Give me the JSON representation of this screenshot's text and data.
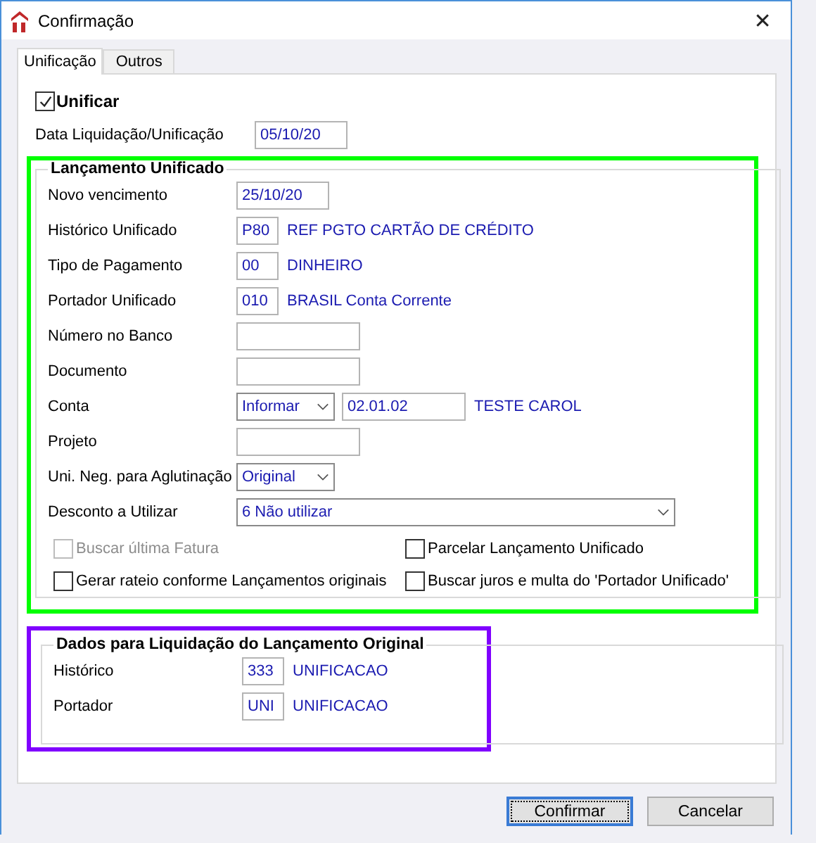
{
  "window": {
    "title": "Confirmação",
    "close": "✕"
  },
  "tabs": [
    {
      "label": "Unificação",
      "selected": true
    },
    {
      "label": "Outros",
      "selected": false
    }
  ],
  "unificar": {
    "label": "Unificar",
    "checked": true
  },
  "data_liquidacao": {
    "label": "Data Liquidação/Unificação",
    "value": "05/10/20"
  },
  "lancamento_unificado": {
    "title": "Lançamento Unificado",
    "color": "#00ff00",
    "rows": [
      {
        "kind": "date",
        "label": "Novo vencimento",
        "value": "25/10/20"
      },
      {
        "kind": "code",
        "label": "Histórico Unificado",
        "value": "P80",
        "description": "REF PGTO CARTÃO DE CRÉDITO"
      },
      {
        "kind": "code",
        "label": "Tipo de Pagamento",
        "value": "00",
        "description": "DINHEIRO"
      },
      {
        "kind": "code",
        "label": "Portador Unificado",
        "value": "010",
        "description": "BRASIL Conta Corrente"
      },
      {
        "kind": "text",
        "label": "Número no Banco"
      },
      {
        "kind": "text",
        "label": "Documento"
      },
      {
        "kind": "account",
        "label": "Conta",
        "select": "Informar",
        "value": "02.01.02",
        "description": "TESTE CAROL"
      },
      {
        "kind": "text",
        "label": "Projeto"
      },
      {
        "kind": "select",
        "label": "Uni. Neg. para Aglutinação",
        "value": "Original"
      },
      {
        "kind": "wide-select",
        "label": "Desconto a Utilizar",
        "value": "6 Não utilizar"
      }
    ],
    "options": [
      {
        "label": "Buscar última Fatura",
        "checked": false,
        "disabled": true
      },
      {
        "label": "Parcelar Lançamento Unificado",
        "checked": false,
        "disabled": false
      },
      {
        "label": "Gerar rateio conforme Lançamentos originais",
        "checked": false,
        "disabled": false
      },
      {
        "label": "Buscar juros e multa do 'Portador Unificado'",
        "checked": false,
        "disabled": false
      }
    ]
  },
  "dados_liquidacao": {
    "title": "Dados para Liquidação do Lançamento Original",
    "color": "#8000ff",
    "rows": [
      {
        "kind": "code",
        "label": "Histórico",
        "value": "333",
        "description": "UNIFICACAO"
      },
      {
        "kind": "code",
        "label": "Portador",
        "value": "UNI",
        "description": "UNIFICACAO"
      }
    ]
  },
  "buttons": [
    {
      "label": "Confirmar",
      "default": true
    },
    {
      "label": "Cancelar",
      "default": false
    }
  ]
}
